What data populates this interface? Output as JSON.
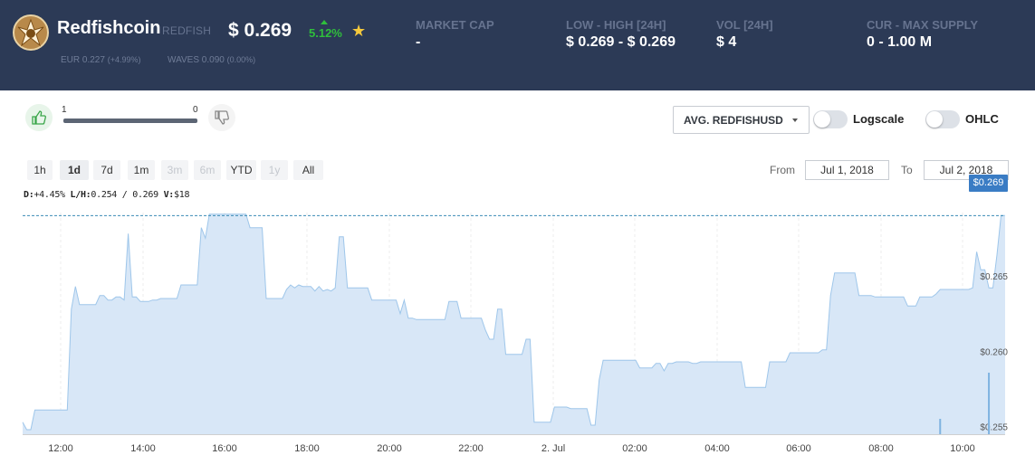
{
  "header": {
    "coin_name": "Redfishcoin",
    "coin_symbol": "REDFISH",
    "price": "$ 0.269",
    "change": "5.12%",
    "eur_label": "EUR",
    "eur_value": "0.227",
    "eur_change": "(+4.99%)",
    "waves_label": "WAVES",
    "waves_value": "0.090",
    "waves_change": "(0.00%)",
    "stats": [
      {
        "label": "MARKET CAP",
        "value": "-"
      },
      {
        "label": "LOW - HIGH [24H]",
        "value": "$ 0.269 - $ 0.269"
      },
      {
        "label": "VOL [24H]",
        "value": "$ 4"
      },
      {
        "label": "CUR - MAX SUPPLY",
        "value": "0 - 1.00 M"
      }
    ]
  },
  "votes": {
    "up": "1",
    "down": "0",
    "up_fraction": 1.0
  },
  "controls": {
    "pair_select": "AVG. REDFISHUSD",
    "logscale_label": "Logscale",
    "logscale_on": false,
    "ohlc_label": "OHLC",
    "ohlc_on": false
  },
  "ranges": [
    {
      "label": "1h",
      "state": "normal"
    },
    {
      "label": "1d",
      "state": "active"
    },
    {
      "label": "7d",
      "state": "normal"
    },
    {
      "label": "1m",
      "state": "normal"
    },
    {
      "label": "3m",
      "state": "disabled"
    },
    {
      "label": "6m",
      "state": "disabled"
    },
    {
      "label": "YTD",
      "state": "normal"
    },
    {
      "label": "1y",
      "state": "disabled"
    },
    {
      "label": "All",
      "state": "normal"
    }
  ],
  "date_range": {
    "from_label": "From",
    "from": "Jul 1, 2018",
    "to_label": "To",
    "to": "Jul 2, 2018"
  },
  "readout": {
    "d": "D:",
    "d_val": "+4.45%",
    "lh": "L/H:",
    "low": "0.254",
    "sep": "/",
    "high": "0.269",
    "v": "V:",
    "v_val": "$18"
  },
  "current_price_tag": "$0.269",
  "chart_data": {
    "type": "area",
    "series": [
      {
        "values": [
          0.2553,
          0.2548,
          0.2548,
          0.2561,
          0.2561,
          0.2561,
          0.2561,
          0.2561,
          0.2561,
          0.2561,
          0.2561,
          0.2561,
          0.2628,
          0.2643,
          0.2631,
          0.2631,
          0.2631,
          0.2631,
          0.2631,
          0.2637,
          0.2637,
          0.2634,
          0.2634,
          0.2636,
          0.2636,
          0.2634,
          0.2678,
          0.2636,
          0.2636,
          0.2633,
          0.2633,
          0.2633,
          0.2634,
          0.2634,
          0.2635,
          0.2635,
          0.2635,
          0.2635,
          0.2635,
          0.2644,
          0.2644,
          0.2644,
          0.2644,
          0.2644,
          0.2682,
          0.2675,
          0.2691,
          0.2691,
          0.2691,
          0.2691,
          0.2691,
          0.2691,
          0.2691,
          0.2691,
          0.2691,
          0.2691,
          0.2682,
          0.2682,
          0.2682,
          0.2682,
          0.2635,
          0.2635,
          0.2635,
          0.2635,
          0.2635,
          0.2641,
          0.2644,
          0.2642,
          0.2644,
          0.2643,
          0.2643,
          0.2643,
          0.264,
          0.2643,
          0.264,
          0.2641,
          0.264,
          0.2642,
          0.2676,
          0.2676,
          0.2642,
          0.2642,
          0.2642,
          0.2642,
          0.2642,
          0.2642,
          0.2634,
          0.2634,
          0.2634,
          0.2634,
          0.2634,
          0.2634,
          0.2634,
          0.2625,
          0.2634,
          0.2622,
          0.2622,
          0.2621,
          0.2621,
          0.2621,
          0.2621,
          0.2621,
          0.2621,
          0.2621,
          0.2621,
          0.2633,
          0.2633,
          0.2633,
          0.2622,
          0.2622,
          0.2622,
          0.2622,
          0.2622,
          0.2622,
          0.2614,
          0.2608,
          0.2608,
          0.2628,
          0.2628,
          0.2598,
          0.2598,
          0.2598,
          0.2598,
          0.2598,
          0.2608,
          0.2608,
          0.2553,
          0.2553,
          0.2553,
          0.2553,
          0.2553,
          0.2563,
          0.2563,
          0.2563,
          0.2563,
          0.2562,
          0.2562,
          0.2562,
          0.2562,
          0.2562,
          0.2551,
          0.2551,
          0.2581,
          0.2594,
          0.2594,
          0.2594,
          0.2594,
          0.2594,
          0.2594,
          0.2594,
          0.2594,
          0.2594,
          0.2589,
          0.2589,
          0.2589,
          0.2589,
          0.2592,
          0.2592,
          0.2587,
          0.2592,
          0.2592,
          0.2593,
          0.2593,
          0.2593,
          0.2593,
          0.2592,
          0.2592,
          0.2593,
          0.2593,
          0.2593,
          0.2593,
          0.2593,
          0.2593,
          0.2593,
          0.2593,
          0.2593,
          0.2593,
          0.2593,
          0.2576,
          0.2576,
          0.2576,
          0.2576,
          0.2576,
          0.2576,
          0.2593,
          0.2593,
          0.2593,
          0.2593,
          0.2593,
          0.2599,
          0.2599,
          0.2599,
          0.2599,
          0.2599,
          0.2599,
          0.2599,
          0.2599,
          0.2601,
          0.2601,
          0.2637,
          0.2652,
          0.2652,
          0.2652,
          0.2652,
          0.2652,
          0.2652,
          0.2637,
          0.2637,
          0.2637,
          0.2637,
          0.2636,
          0.2636,
          0.2636,
          0.2636,
          0.2636,
          0.2636,
          0.2636,
          0.2636,
          0.263,
          0.263,
          0.263,
          0.2636,
          0.2636,
          0.2636,
          0.2636,
          0.2638,
          0.2641,
          0.2641,
          0.2641,
          0.2641,
          0.2641,
          0.2641,
          0.2641,
          0.2641,
          0.2642,
          0.2666,
          0.2654,
          0.2654,
          0.2642,
          0.2642,
          0.2664,
          0.269,
          0.269
        ]
      }
    ],
    "time_labels": [
      "12:00",
      "14:00",
      "16:00",
      "18:00",
      "20:00",
      "22:00",
      "2. Jul",
      "02:00",
      "04:00",
      "06:00",
      "08:00",
      "10:00"
    ],
    "y_ticks": [
      "$0.255",
      "$0.260",
      "$0.265"
    ],
    "ylim": [
      0.2545,
      0.2695
    ],
    "volume_bars": [
      {
        "index": 226,
        "value": 1
      },
      {
        "index": 238,
        "value": 4
      }
    ],
    "grid": true,
    "last_value_line": 0.269
  },
  "colors": {
    "header_bg": "#2c3a56",
    "area_fill": "#d8e7f7",
    "line": "#9ec6ea",
    "accent": "#3a7cc4",
    "up": "#2fbe3c",
    "star": "#f6c93c"
  }
}
